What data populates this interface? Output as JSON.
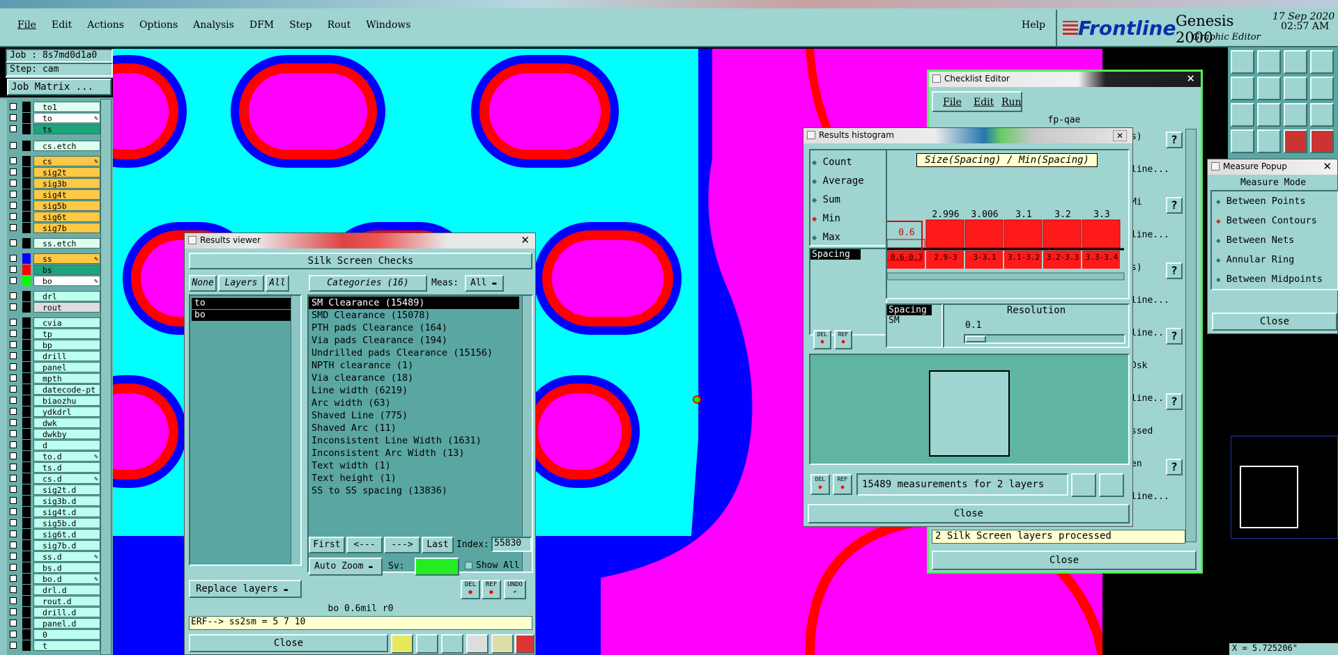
{
  "app": {
    "title_brand": "Frontline",
    "product": "Genesis 2000",
    "subtitle": "Graphic Editor",
    "date": "17 Sep 2020",
    "time": "02:57 AM"
  },
  "menu": [
    "File",
    "Edit",
    "Actions",
    "Options",
    "Analysis",
    "DFM",
    "Step",
    "Rout",
    "Windows"
  ],
  "help": "Help",
  "job": {
    "job": "Job : 8s7md0d1a0",
    "step": "Step: cam",
    "matrix_btn": "Job Matrix ..."
  },
  "layers": [
    {
      "name": "to1",
      "color": "#dfe",
      "sw": "#000"
    },
    {
      "name": "to",
      "color": "#fff",
      "sw": "#000",
      "edit": true
    },
    {
      "name": "ts",
      "color": "#1aa67a",
      "sw": "#000"
    },
    {
      "name": "cs.etch",
      "color": "#dfe",
      "sw": "#000"
    },
    {
      "name": "cs",
      "color": "#ffc845",
      "sw": "#000",
      "edit": true
    },
    {
      "name": "sig2t",
      "color": "#ffc845",
      "sw": "#000"
    },
    {
      "name": "sig3b",
      "color": "#ffc845",
      "sw": "#000"
    },
    {
      "name": "sig4t",
      "color": "#ffc845",
      "sw": "#000"
    },
    {
      "name": "sig5b",
      "color": "#ffc845",
      "sw": "#000"
    },
    {
      "name": "sig6t",
      "color": "#ffc845",
      "sw": "#000"
    },
    {
      "name": "sig7b",
      "color": "#ffc845",
      "sw": "#000"
    },
    {
      "name": "ss.etch",
      "color": "#dfe",
      "sw": "#000"
    },
    {
      "name": "ss",
      "color": "#ffc845",
      "sw": "#0000ff",
      "edit": true
    },
    {
      "name": "bs",
      "color": "#1aa67a",
      "sw": "#ff0000"
    },
    {
      "name": "bo",
      "color": "#fff",
      "sw": "#00ff00",
      "edit": true
    },
    {
      "name": "drl",
      "color": "#bfe",
      "sw": "#000"
    },
    {
      "name": "rout",
      "color": "#ddd",
      "sw": "#000"
    },
    {
      "name": "cvia",
      "color": "#bfe",
      "sw": "#000"
    },
    {
      "name": "tp",
      "color": "#bfe",
      "sw": "#000"
    },
    {
      "name": "bp",
      "color": "#bfe",
      "sw": "#000"
    },
    {
      "name": "drill",
      "color": "#bfe",
      "sw": "#000"
    },
    {
      "name": "panel",
      "color": "#bfe",
      "sw": "#000"
    },
    {
      "name": "mpth",
      "color": "#bfe",
      "sw": "#000"
    },
    {
      "name": "datecode-pt",
      "color": "#bfe",
      "sw": "#000"
    },
    {
      "name": "biaozhu",
      "color": "#bfe",
      "sw": "#000"
    },
    {
      "name": "ydkdrl",
      "color": "#bfe",
      "sw": "#000"
    },
    {
      "name": "dwk",
      "color": "#bfe",
      "sw": "#000"
    },
    {
      "name": "dwkby",
      "color": "#bfe",
      "sw": "#000"
    },
    {
      "name": "d",
      "color": "#bfe",
      "sw": "#000"
    },
    {
      "name": "to.d",
      "color": "#bfe",
      "sw": "#000",
      "edit": true
    },
    {
      "name": "ts.d",
      "color": "#bfe",
      "sw": "#000"
    },
    {
      "name": "cs.d",
      "color": "#bfe",
      "sw": "#000",
      "edit": true
    },
    {
      "name": "sig2t.d",
      "color": "#bfe",
      "sw": "#000"
    },
    {
      "name": "sig3b.d",
      "color": "#bfe",
      "sw": "#000"
    },
    {
      "name": "sig4t.d",
      "color": "#bfe",
      "sw": "#000"
    },
    {
      "name": "sig5b.d",
      "color": "#bfe",
      "sw": "#000"
    },
    {
      "name": "sig6t.d",
      "color": "#bfe",
      "sw": "#000"
    },
    {
      "name": "sig7b.d",
      "color": "#bfe",
      "sw": "#000"
    },
    {
      "name": "ss.d",
      "color": "#bfe",
      "sw": "#000",
      "edit": true
    },
    {
      "name": "bs.d",
      "color": "#bfe",
      "sw": "#000"
    },
    {
      "name": "bo.d",
      "color": "#bfe",
      "sw": "#000",
      "edit": true
    },
    {
      "name": "drl.d",
      "color": "#bfe",
      "sw": "#000"
    },
    {
      "name": "rout.d",
      "color": "#bfe",
      "sw": "#000"
    },
    {
      "name": "drill.d",
      "color": "#bfe",
      "sw": "#000"
    },
    {
      "name": "panel.d",
      "color": "#bfe",
      "sw": "#000"
    },
    {
      "name": "0",
      "color": "#bfe",
      "sw": "#000"
    },
    {
      "name": "t",
      "color": "#bfe",
      "sw": "#000"
    }
  ],
  "results_viewer": {
    "title": "Results viewer",
    "header": "Silk Screen Checks",
    "none": "None",
    "layers_btn": "Layers",
    "all": "All",
    "categories_btn": "Categories (16)",
    "meas_label": "Meas:",
    "meas_value": "All",
    "layer_items": [
      "to",
      "bo"
    ],
    "categories": [
      "SM Clearance (15489)",
      "SMD Clearance (15078)",
      "PTH pads Clearance (164)",
      "Via pads Clearance (194)",
      "Undrilled pads Clearance (15156)",
      "NPTH clearance (1)",
      "Via clearance (18)",
      "Line width (6219)",
      "Arc width (63)",
      "Shaved Line (775)",
      "Shaved Arc (11)",
      "Inconsistent Line Width (1631)",
      "Inconsistent Arc Width (13)",
      "Text width (1)",
      "Text height (1)",
      "SS to SS spacing (13836)"
    ],
    "first": "First",
    "prev": "<---",
    "next": "--->",
    "last": "Last",
    "index_label": "Index:",
    "index_value": "55830",
    "auto_zoom": "Auto Zoom",
    "sv_label": "Sv:",
    "show_all": "Show All",
    "replace_layers": "Replace layers",
    "del": "DEL",
    "ref": "REF",
    "undo": "UNDO",
    "status": "bo 0.6mil  r0",
    "erf": "ERF--> ss2sm = 5 7 10",
    "close": "Close"
  },
  "histogram": {
    "title": "Results histogram",
    "modes": [
      "Count",
      "Average",
      "Sum",
      "Min",
      "Max"
    ],
    "selected_mode": "Min",
    "chart_title": "Size(Spacing) / Min(Spacing)",
    "list_item": "Spacing",
    "bars": [
      {
        "label": "0.6",
        "range": "0.6-0.7"
      },
      {
        "label": "2.996",
        "range": "2.9-3"
      },
      {
        "label": "3.006",
        "range": "3-3.1"
      },
      {
        "label": "3.1",
        "range": "3.1-3.2"
      },
      {
        "label": "3.2",
        "range": "3.2-3.3"
      },
      {
        "label": "3.3",
        "range": "3.3-3.4"
      }
    ],
    "spacing_sm": [
      "Spacing",
      "SM"
    ],
    "resolution_label": "Resolution",
    "resolution_value": "0.1",
    "del": "DEL",
    "ref": "REF",
    "measurements": "15489 measurements for 2 layers",
    "close": "Close"
  },
  "checklist": {
    "title": "Checklist Editor",
    "menu": [
      "File",
      "Edit",
      "Run"
    ],
    "name": "fp-qae",
    "status": "2 Silk Screen layers processed",
    "close": "Close",
    "side_labels": [
      "s)",
      "line...",
      "Mi",
      "line...",
      "s)",
      "line...",
      "line...",
      "Dsk",
      "line...",
      "ssed",
      "en",
      "line..."
    ]
  },
  "measure": {
    "title": "Measure Popup",
    "mode_label": "Measure Mode",
    "modes": [
      "Between Points",
      "Between Contours",
      "Between Nets",
      "Annular Ring",
      "Between Midpoints"
    ],
    "selected": "Between Contours",
    "close": "Close"
  },
  "coord": "X = 5.725206\""
}
